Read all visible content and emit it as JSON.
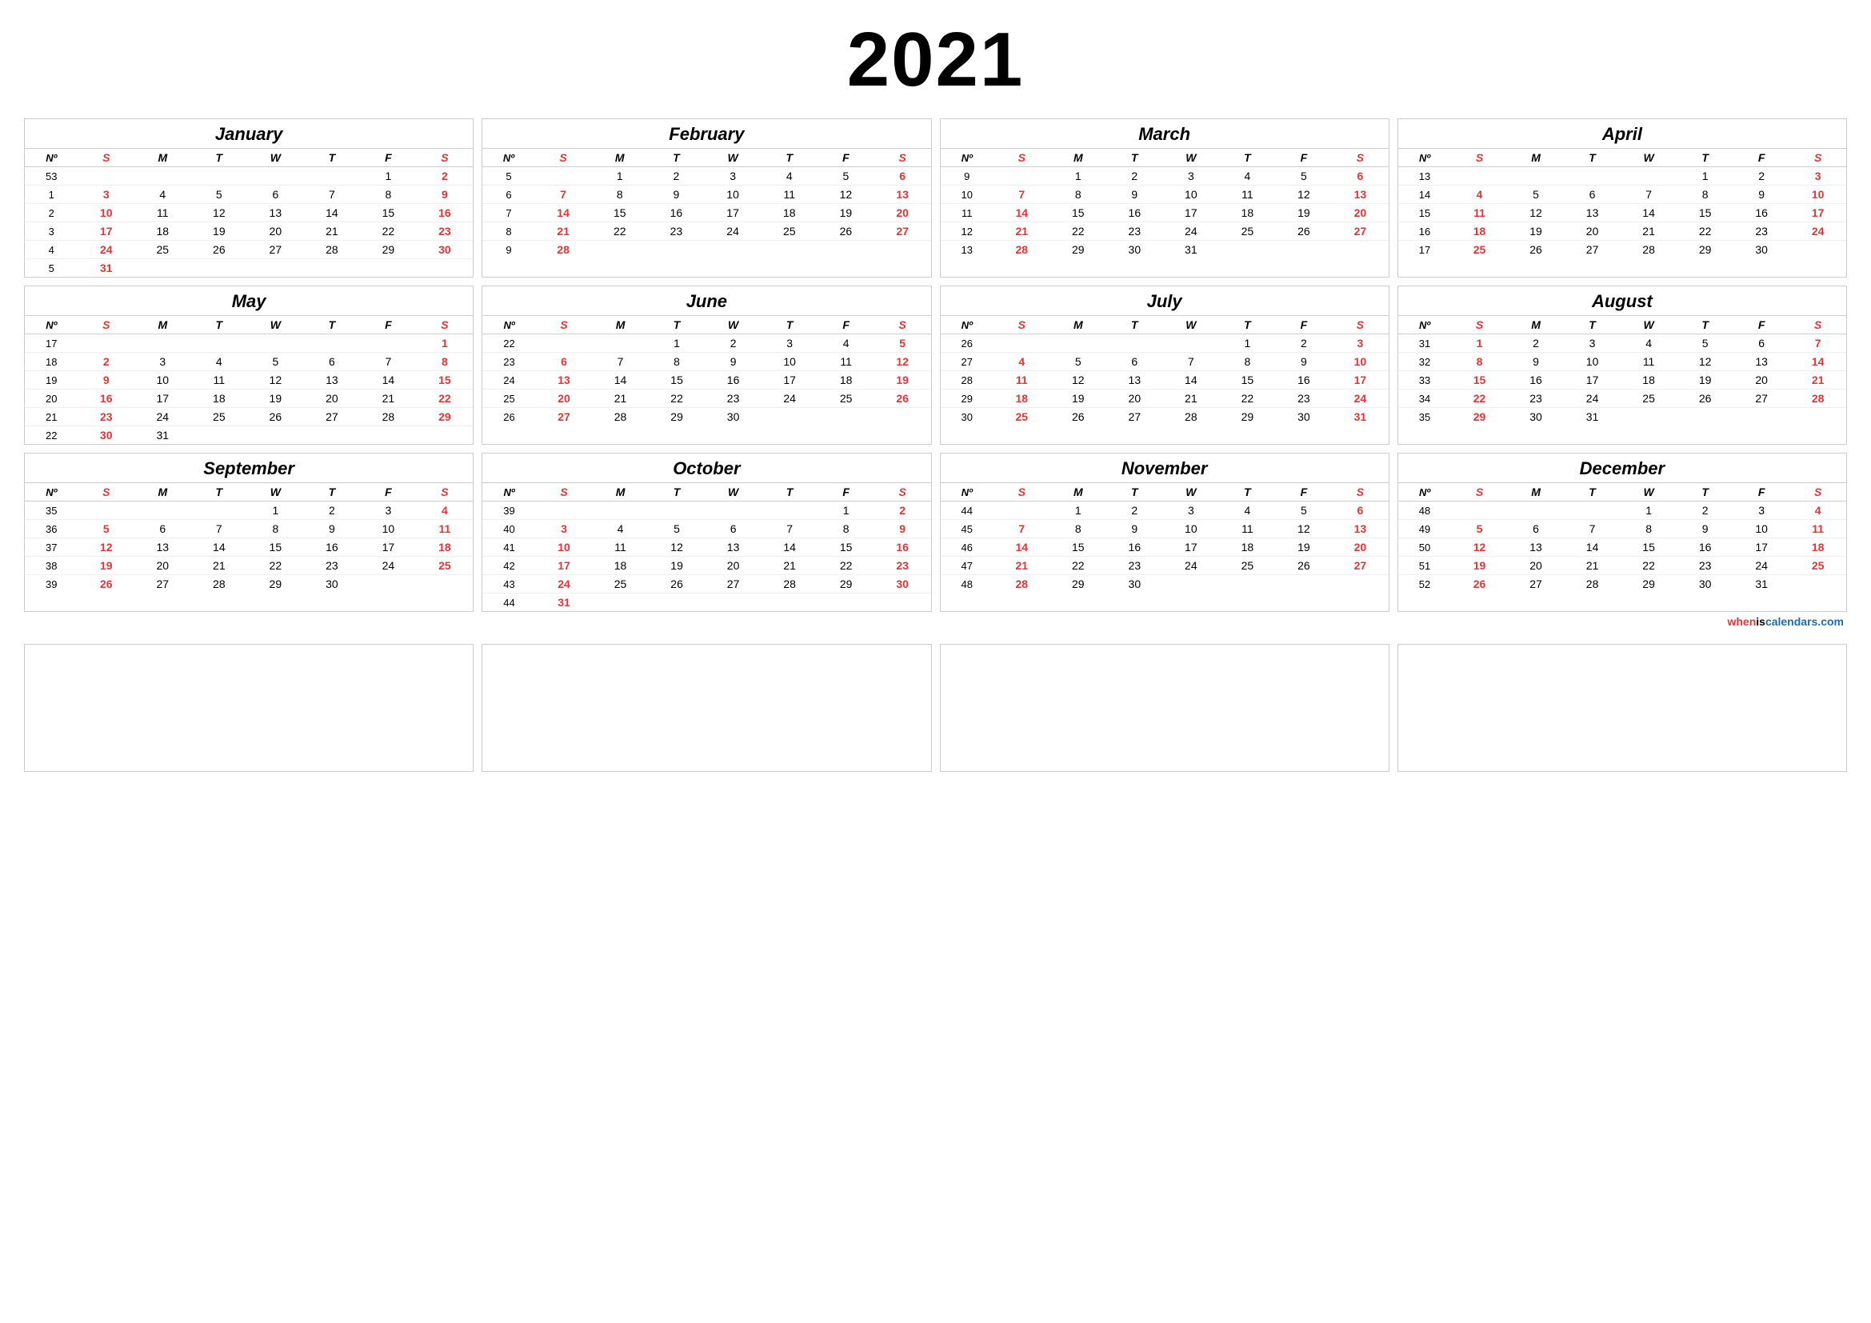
{
  "year": "2021",
  "months": [
    {
      "name": "January",
      "weeks": [
        {
          "wn": "53",
          "s": "",
          "m": "",
          "t": "",
          "w": "",
          "th": "",
          "f": "1",
          "sa": "2"
        },
        {
          "wn": "1",
          "s": "3",
          "m": "4",
          "t": "5",
          "w": "6",
          "th": "7",
          "f": "8",
          "sa": "9"
        },
        {
          "wn": "2",
          "s": "10",
          "m": "11",
          "t": "12",
          "w": "13",
          "th": "14",
          "f": "15",
          "sa": "16"
        },
        {
          "wn": "3",
          "s": "17",
          "m": "18",
          "t": "19",
          "w": "20",
          "th": "21",
          "f": "22",
          "sa": "23"
        },
        {
          "wn": "4",
          "s": "24",
          "m": "25",
          "t": "26",
          "w": "27",
          "th": "28",
          "f": "29",
          "sa": "30"
        },
        {
          "wn": "5",
          "s": "31",
          "m": "",
          "t": "",
          "w": "",
          "th": "",
          "f": "",
          "sa": ""
        }
      ]
    },
    {
      "name": "February",
      "weeks": [
        {
          "wn": "5",
          "s": "",
          "m": "1",
          "t": "2",
          "w": "3",
          "th": "4",
          "f": "5",
          "sa": "6"
        },
        {
          "wn": "6",
          "s": "7",
          "m": "8",
          "t": "9",
          "w": "10",
          "th": "11",
          "f": "12",
          "sa": "13"
        },
        {
          "wn": "7",
          "s": "14",
          "m": "15",
          "t": "16",
          "w": "17",
          "th": "18",
          "f": "19",
          "sa": "20"
        },
        {
          "wn": "8",
          "s": "21",
          "m": "22",
          "t": "23",
          "w": "24",
          "th": "25",
          "f": "26",
          "sa": "27"
        },
        {
          "wn": "9",
          "s": "28",
          "m": "",
          "t": "",
          "w": "",
          "th": "",
          "f": "",
          "sa": ""
        }
      ]
    },
    {
      "name": "March",
      "weeks": [
        {
          "wn": "9",
          "s": "",
          "m": "1",
          "t": "2",
          "w": "3",
          "th": "4",
          "f": "5",
          "sa": "6"
        },
        {
          "wn": "10",
          "s": "7",
          "m": "8",
          "t": "9",
          "w": "10",
          "th": "11",
          "f": "12",
          "sa": "13"
        },
        {
          "wn": "11",
          "s": "14",
          "m": "15",
          "t": "16",
          "w": "17",
          "th": "18",
          "f": "19",
          "sa": "20"
        },
        {
          "wn": "12",
          "s": "21",
          "m": "22",
          "t": "23",
          "w": "24",
          "th": "25",
          "f": "26",
          "sa": "27"
        },
        {
          "wn": "13",
          "s": "28",
          "m": "29",
          "t": "30",
          "w": "31",
          "th": "",
          "f": "",
          "sa": ""
        }
      ]
    },
    {
      "name": "April",
      "weeks": [
        {
          "wn": "13",
          "s": "",
          "m": "",
          "t": "",
          "w": "",
          "th": "1",
          "f": "2",
          "sa": "3"
        },
        {
          "wn": "14",
          "s": "4",
          "m": "5",
          "t": "6",
          "w": "7",
          "th": "8",
          "f": "9",
          "sa": "10"
        },
        {
          "wn": "15",
          "s": "11",
          "m": "12",
          "t": "13",
          "w": "14",
          "th": "15",
          "f": "16",
          "sa": "17"
        },
        {
          "wn": "16",
          "s": "18",
          "m": "19",
          "t": "20",
          "w": "21",
          "th": "22",
          "f": "23",
          "sa": "24"
        },
        {
          "wn": "17",
          "s": "25",
          "m": "26",
          "t": "27",
          "w": "28",
          "th": "29",
          "f": "30",
          "sa": ""
        }
      ]
    },
    {
      "name": "May",
      "weeks": [
        {
          "wn": "17",
          "s": "",
          "m": "",
          "t": "",
          "w": "",
          "th": "",
          "f": "",
          "sa": "1"
        },
        {
          "wn": "18",
          "s": "2",
          "m": "3",
          "t": "4",
          "w": "5",
          "th": "6",
          "f": "7",
          "sa": "8"
        },
        {
          "wn": "19",
          "s": "9",
          "m": "10",
          "t": "11",
          "w": "12",
          "th": "13",
          "f": "14",
          "sa": "15"
        },
        {
          "wn": "20",
          "s": "16",
          "m": "17",
          "t": "18",
          "w": "19",
          "th": "20",
          "f": "21",
          "sa": "22"
        },
        {
          "wn": "21",
          "s": "23",
          "m": "24",
          "t": "25",
          "w": "26",
          "th": "27",
          "f": "28",
          "sa": "29"
        },
        {
          "wn": "22",
          "s": "30",
          "m": "31",
          "t": "",
          "w": "",
          "th": "",
          "f": "",
          "sa": ""
        }
      ]
    },
    {
      "name": "June",
      "weeks": [
        {
          "wn": "22",
          "s": "",
          "m": "",
          "t": "1",
          "w": "2",
          "th": "3",
          "f": "4",
          "sa": "5"
        },
        {
          "wn": "23",
          "s": "6",
          "m": "7",
          "t": "8",
          "w": "9",
          "th": "10",
          "f": "11",
          "sa": "12"
        },
        {
          "wn": "24",
          "s": "13",
          "m": "14",
          "t": "15",
          "w": "16",
          "th": "17",
          "f": "18",
          "sa": "19"
        },
        {
          "wn": "25",
          "s": "20",
          "m": "21",
          "t": "22",
          "w": "23",
          "th": "24",
          "f": "25",
          "sa": "26"
        },
        {
          "wn": "26",
          "s": "27",
          "m": "28",
          "t": "29",
          "w": "30",
          "th": "",
          "f": "",
          "sa": ""
        }
      ]
    },
    {
      "name": "July",
      "weeks": [
        {
          "wn": "26",
          "s": "",
          "m": "",
          "t": "",
          "w": "",
          "th": "1",
          "f": "2",
          "sa": "3"
        },
        {
          "wn": "27",
          "s": "4",
          "m": "5",
          "t": "6",
          "w": "7",
          "th": "8",
          "f": "9",
          "sa": "10"
        },
        {
          "wn": "28",
          "s": "11",
          "m": "12",
          "t": "13",
          "w": "14",
          "th": "15",
          "f": "16",
          "sa": "17"
        },
        {
          "wn": "29",
          "s": "18",
          "m": "19",
          "t": "20",
          "w": "21",
          "th": "22",
          "f": "23",
          "sa": "24"
        },
        {
          "wn": "30",
          "s": "25",
          "m": "26",
          "t": "27",
          "w": "28",
          "th": "29",
          "f": "30",
          "sa": "31"
        }
      ]
    },
    {
      "name": "August",
      "weeks": [
        {
          "wn": "31",
          "s": "1",
          "m": "2",
          "t": "3",
          "w": "4",
          "th": "5",
          "f": "6",
          "sa": "7"
        },
        {
          "wn": "32",
          "s": "8",
          "m": "9",
          "t": "10",
          "w": "11",
          "th": "12",
          "f": "13",
          "sa": "14"
        },
        {
          "wn": "33",
          "s": "15",
          "m": "16",
          "t": "17",
          "w": "18",
          "th": "19",
          "f": "20",
          "sa": "21"
        },
        {
          "wn": "34",
          "s": "22",
          "m": "23",
          "t": "24",
          "w": "25",
          "th": "26",
          "f": "27",
          "sa": "28"
        },
        {
          "wn": "35",
          "s": "29",
          "m": "30",
          "t": "31",
          "w": "",
          "th": "",
          "f": "",
          "sa": ""
        }
      ]
    },
    {
      "name": "September",
      "weeks": [
        {
          "wn": "35",
          "s": "",
          "m": "",
          "t": "",
          "w": "1",
          "th": "2",
          "f": "3",
          "sa": "4"
        },
        {
          "wn": "36",
          "s": "5",
          "m": "6",
          "t": "7",
          "w": "8",
          "th": "9",
          "f": "10",
          "sa": "11"
        },
        {
          "wn": "37",
          "s": "12",
          "m": "13",
          "t": "14",
          "w": "15",
          "th": "16",
          "f": "17",
          "sa": "18"
        },
        {
          "wn": "38",
          "s": "19",
          "m": "20",
          "t": "21",
          "w": "22",
          "th": "23",
          "f": "24",
          "sa": "25"
        },
        {
          "wn": "39",
          "s": "26",
          "m": "27",
          "t": "28",
          "w": "29",
          "th": "30",
          "f": "",
          "sa": ""
        }
      ]
    },
    {
      "name": "October",
      "weeks": [
        {
          "wn": "39",
          "s": "",
          "m": "",
          "t": "",
          "w": "",
          "th": "",
          "f": "1",
          "sa": "2"
        },
        {
          "wn": "40",
          "s": "3",
          "m": "4",
          "t": "5",
          "w": "6",
          "th": "7",
          "f": "8",
          "sa": "9"
        },
        {
          "wn": "41",
          "s": "10",
          "m": "11",
          "t": "12",
          "w": "13",
          "th": "14",
          "f": "15",
          "sa": "16"
        },
        {
          "wn": "42",
          "s": "17",
          "m": "18",
          "t": "19",
          "w": "20",
          "th": "21",
          "f": "22",
          "sa": "23"
        },
        {
          "wn": "43",
          "s": "24",
          "m": "25",
          "t": "26",
          "w": "27",
          "th": "28",
          "f": "29",
          "sa": "30"
        },
        {
          "wn": "44",
          "s": "31",
          "m": "",
          "t": "",
          "w": "",
          "th": "",
          "f": "",
          "sa": ""
        }
      ]
    },
    {
      "name": "November",
      "weeks": [
        {
          "wn": "44",
          "s": "",
          "m": "1",
          "t": "2",
          "w": "3",
          "th": "4",
          "f": "5",
          "sa": "6"
        },
        {
          "wn": "45",
          "s": "7",
          "m": "8",
          "t": "9",
          "w": "10",
          "th": "11",
          "f": "12",
          "sa": "13"
        },
        {
          "wn": "46",
          "s": "14",
          "m": "15",
          "t": "16",
          "w": "17",
          "th": "18",
          "f": "19",
          "sa": "20"
        },
        {
          "wn": "47",
          "s": "21",
          "m": "22",
          "t": "23",
          "w": "24",
          "th": "25",
          "f": "26",
          "sa": "27"
        },
        {
          "wn": "48",
          "s": "28",
          "m": "29",
          "t": "30",
          "w": "",
          "th": "",
          "f": "",
          "sa": ""
        }
      ]
    },
    {
      "name": "December",
      "weeks": [
        {
          "wn": "48",
          "s": "",
          "m": "",
          "t": "",
          "w": "1",
          "th": "2",
          "f": "3",
          "sa": "4"
        },
        {
          "wn": "49",
          "s": "5",
          "m": "6",
          "t": "7",
          "w": "8",
          "th": "9",
          "f": "10",
          "sa": "11"
        },
        {
          "wn": "50",
          "s": "12",
          "m": "13",
          "t": "14",
          "w": "15",
          "th": "16",
          "f": "17",
          "sa": "18"
        },
        {
          "wn": "51",
          "s": "19",
          "m": "20",
          "t": "21",
          "w": "22",
          "th": "23",
          "f": "24",
          "sa": "25"
        },
        {
          "wn": "52",
          "s": "26",
          "m": "27",
          "t": "28",
          "w": "29",
          "th": "30",
          "f": "31",
          "sa": ""
        }
      ]
    }
  ],
  "header_cols": [
    "Nº",
    "S",
    "M",
    "T",
    "W",
    "T",
    "F",
    "S"
  ],
  "watermark": {
    "when": "when",
    "is": "is",
    "cal": "calendars.com"
  }
}
